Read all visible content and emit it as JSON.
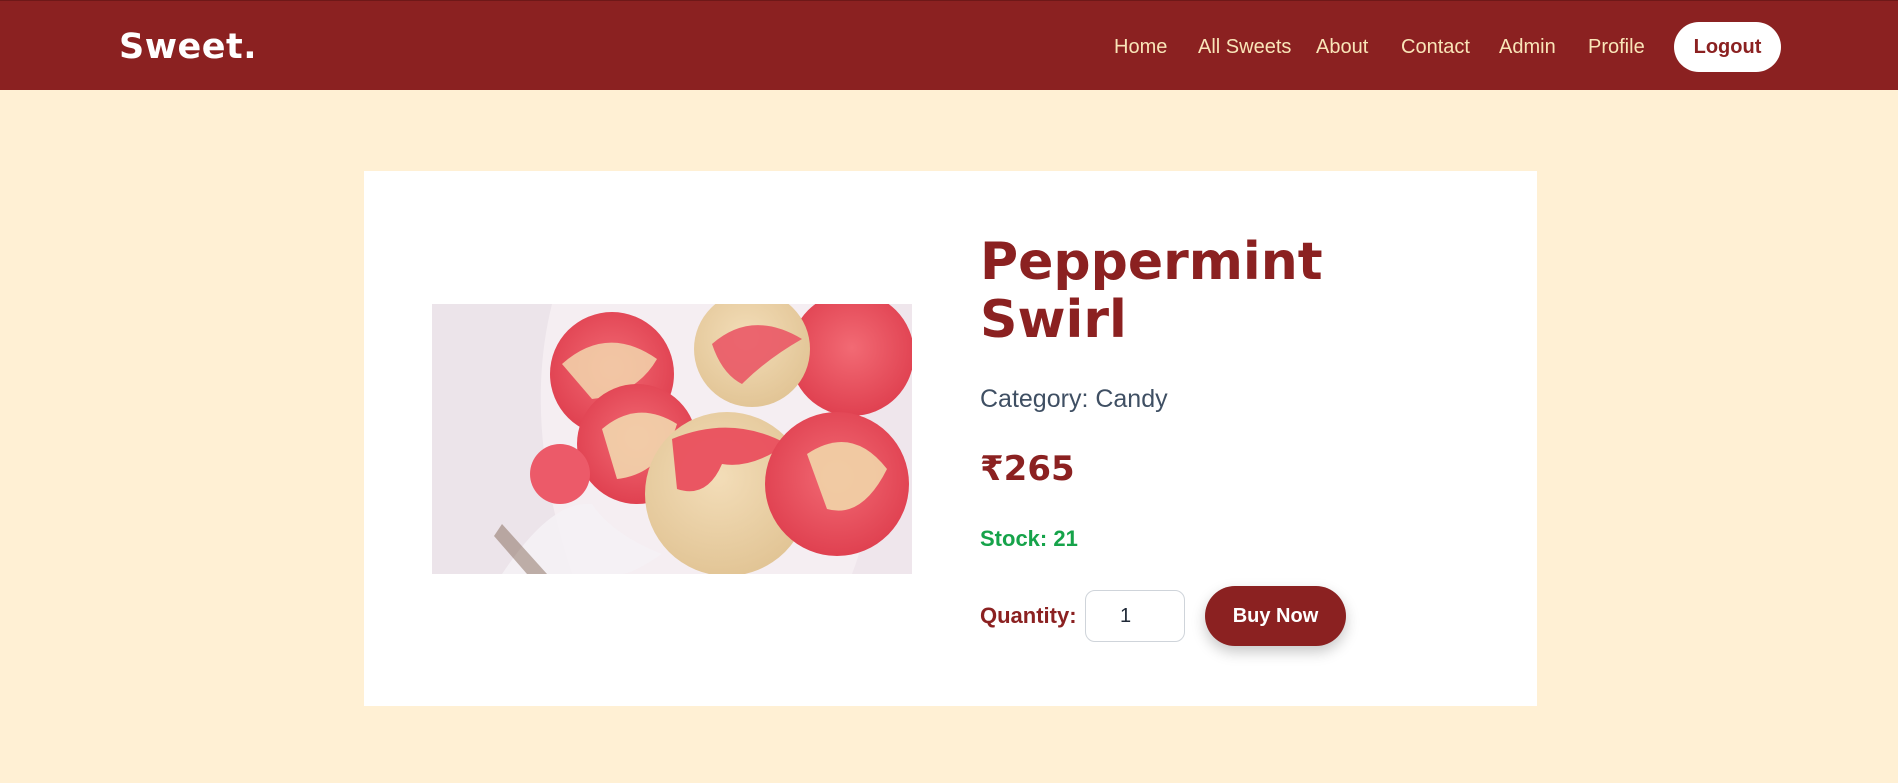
{
  "header": {
    "logo": "Sweet.",
    "nav": [
      "Home",
      "All Sweets",
      "About",
      "Contact",
      "Admin",
      "Profile"
    ],
    "logout_label": "Logout"
  },
  "product": {
    "name": "Peppermint Swirl",
    "category_line": "Category: Candy",
    "price": "₹265",
    "stock_line": "Stock: 21",
    "quantity_label": "Quantity:",
    "quantity_value": "1",
    "buy_label": "Buy Now"
  },
  "colors": {
    "brand": "#8b2121",
    "background": "#fff0d4",
    "nav_text": "#f9e5b8",
    "stock": "#16a34a"
  }
}
